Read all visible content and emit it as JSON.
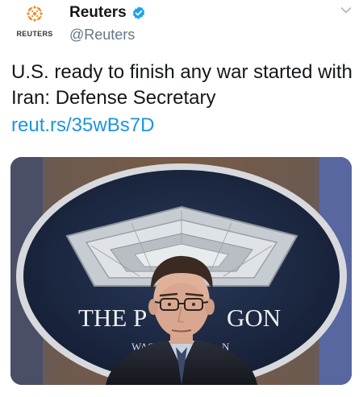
{
  "account": {
    "display_name": "Reuters",
    "handle": "@Reuters",
    "logo_text": "REUTERS",
    "verified": true,
    "verified_icon": "verified-badge-icon"
  },
  "tweet": {
    "text": "U.S. ready to finish any war started with Iran: Defense Secretary",
    "link": "reut.rs/35wBs7D"
  },
  "media": {
    "podium_sign_visible": "THE P GON",
    "podium_sign_part1": "THE P",
    "podium_sign_part2": "GON",
    "podium_sub_part1": "WAS",
    "podium_sub_part2": "N"
  },
  "colors": {
    "link": "#1b95e0",
    "verified": "#1da1f2",
    "handle": "#657786",
    "logo_orange": "#f38b1a"
  },
  "icons": [
    "reuters-logo-icon",
    "verified-badge-icon",
    "chevron-down-icon"
  ]
}
